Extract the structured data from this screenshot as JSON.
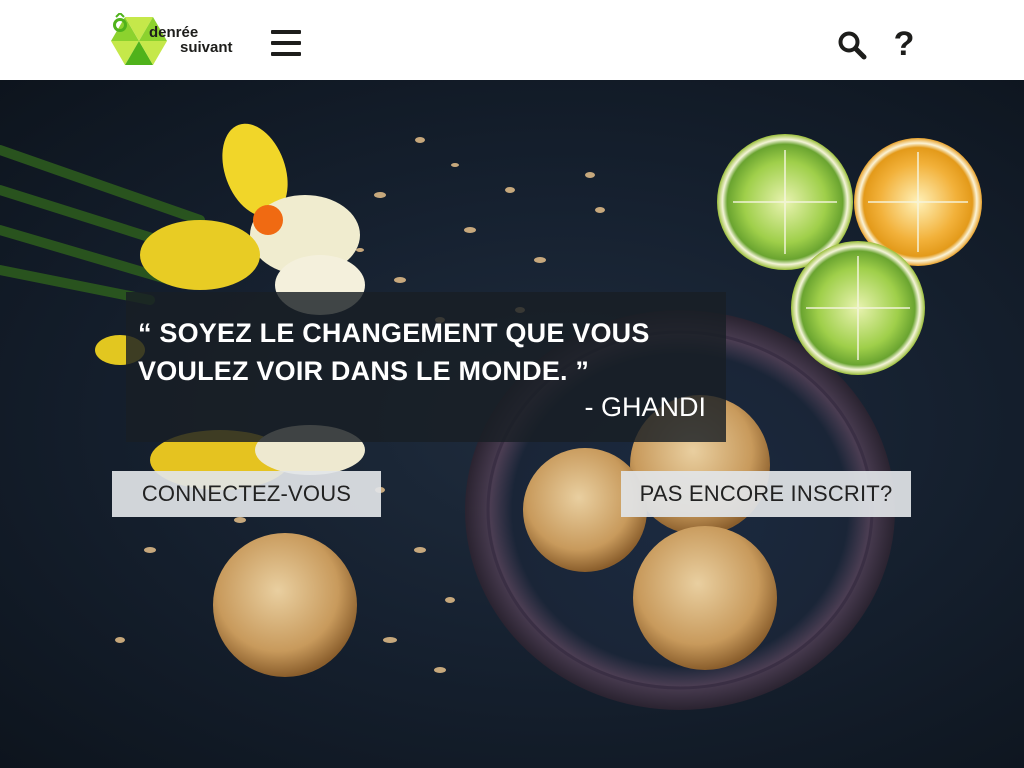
{
  "header": {
    "logo": {
      "line1": "denrée",
      "line2": "suivant",
      "colors": {
        "light_green": "#c5e84a",
        "mid_green": "#8cd22e",
        "dark_green": "#4fb21b",
        "text": "#1d1d1b"
      }
    },
    "menu_icon": "hamburger-menu-icon",
    "search_icon": "search-icon",
    "help": {
      "icon": "question-mark-icon",
      "label": "?"
    }
  },
  "hero": {
    "background": "dark table with daffodils, sliced lemons, almond cookies in a bowl",
    "quote": {
      "text": "“ SOYEZ LE CHANGEMENT QUE VOUS VOULEZ VOIR DANS LE MONDE. ”",
      "author": "- GHANDI"
    },
    "buttons": {
      "login": "CONNECTEZ-VOUS",
      "signup": "PAS ENCORE INSCRIT?"
    }
  }
}
